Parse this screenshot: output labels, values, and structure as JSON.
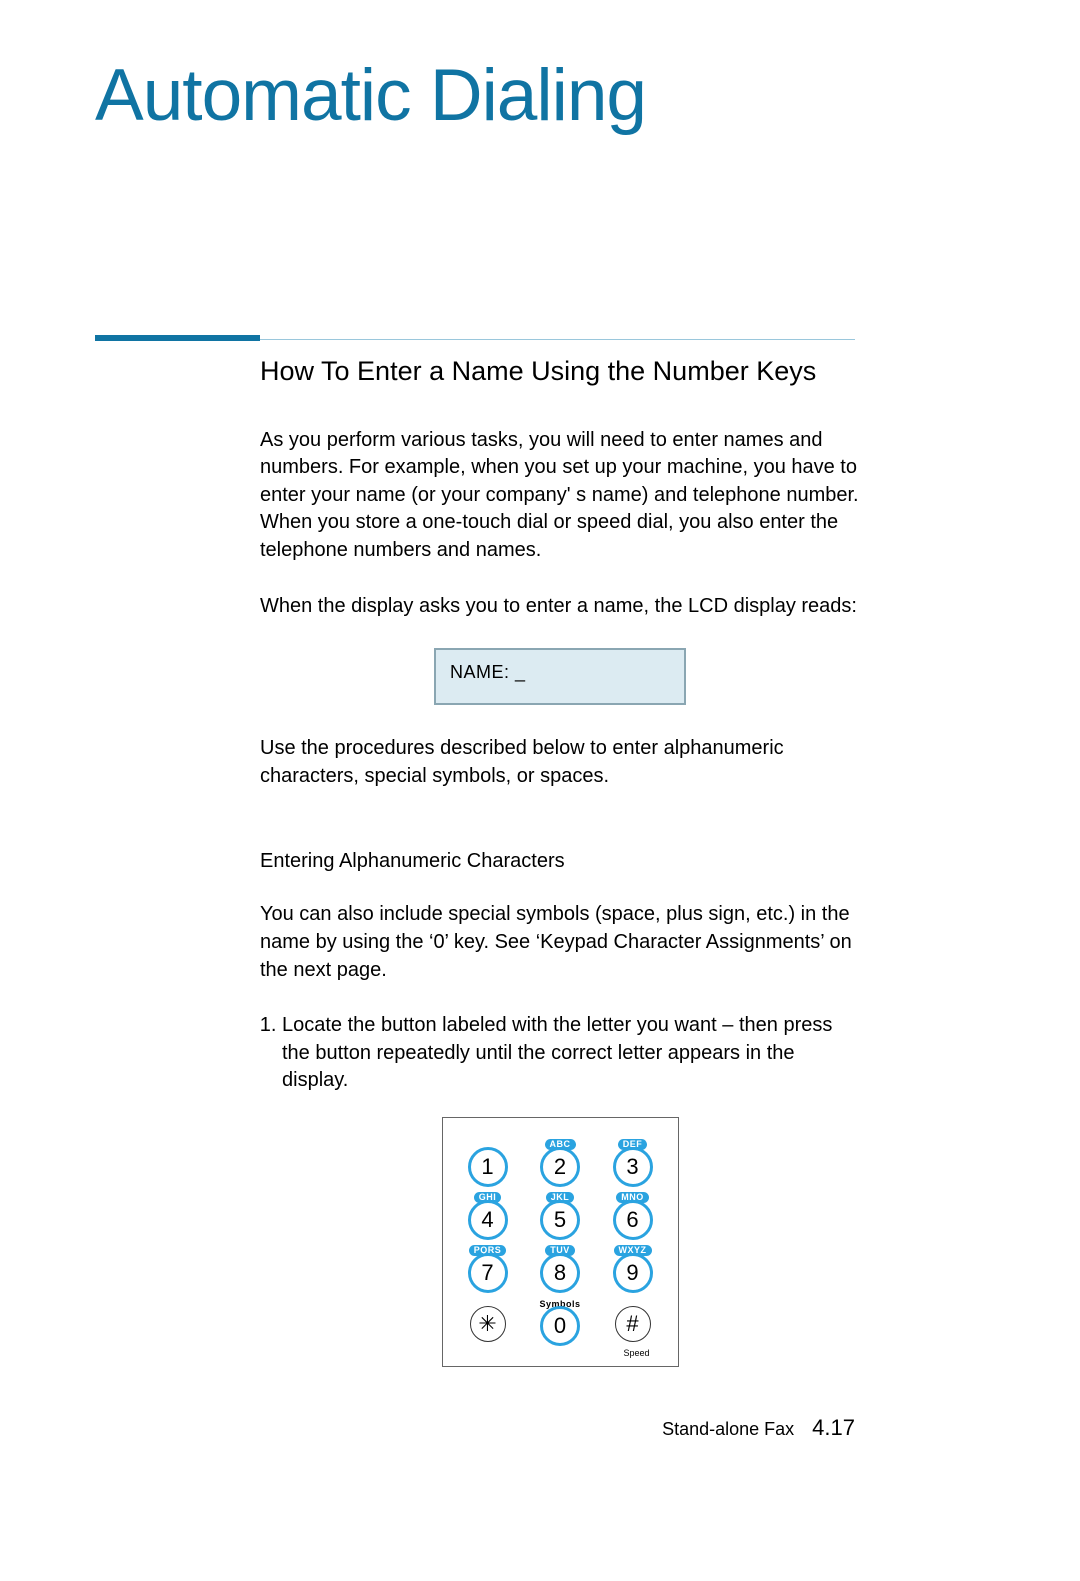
{
  "title": "Automatic Dialing",
  "section_heading": "How To Enter a Name Using the Number Keys",
  "para1": "As you perform various tasks, you will need to enter names and numbers. For example, when you set up your machine, you have to enter your name (or your company' s name) and telephone number. When you store a one-touch dial or speed dial, you also enter the telephone numbers and names.",
  "para2": "When the display asks you to enter a name, the LCD display reads:",
  "lcd_text": "NAME: _",
  "para3": "Use the procedures described below to enter alphanumeric characters, special symbols, or spaces.",
  "sub_heading": "Entering Alphanumeric Characters",
  "para4": "You can also include special symbols (space, plus sign, etc.) in the name by using the ‘0’ key. See ‘Keypad Character Assignments’ on the next page.",
  "step1": "Locate the button labeled with the letter you want – then press the button repeatedly until the correct letter appears in the display.",
  "keypad": {
    "rows": [
      [
        {
          "label": "",
          "pill": false,
          "digit": "1"
        },
        {
          "label": "ABC",
          "pill": true,
          "digit": "2"
        },
        {
          "label": "DEF",
          "pill": true,
          "digit": "3"
        }
      ],
      [
        {
          "label": "GHI",
          "pill": true,
          "digit": "4"
        },
        {
          "label": "JKL",
          "pill": true,
          "digit": "5"
        },
        {
          "label": "MNO",
          "pill": true,
          "digit": "6"
        }
      ],
      [
        {
          "label": "PQRS",
          "pill": true,
          "digit": "7"
        },
        {
          "label": "TUV",
          "pill": true,
          "digit": "8"
        },
        {
          "label": "WXYZ",
          "pill": true,
          "digit": "9"
        }
      ],
      [
        {
          "label": "",
          "pill": false,
          "digit": "✳",
          "thin": true
        },
        {
          "label": "Symbols",
          "pill": false,
          "digit": "0"
        },
        {
          "label": "",
          "pill": false,
          "digit": "#",
          "thin": true
        }
      ]
    ],
    "speed_label": "Speed"
  },
  "footer_section": "Stand-alone Fax",
  "footer_page": "4.17"
}
